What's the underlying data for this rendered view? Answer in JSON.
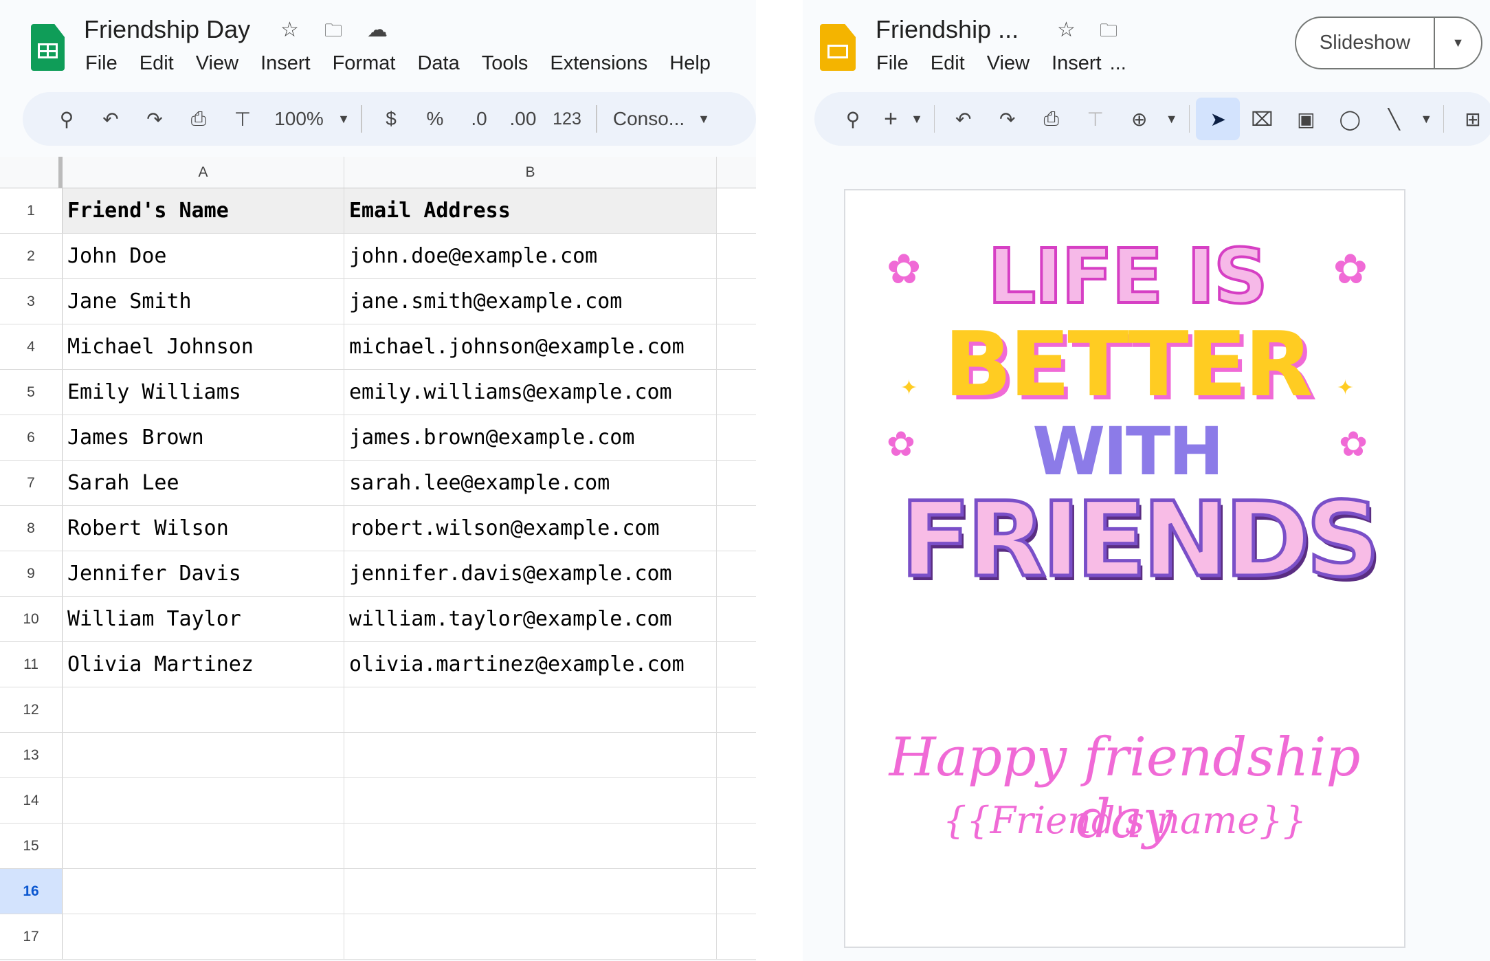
{
  "sheets": {
    "title": "Friendship Day",
    "menu": [
      "File",
      "Edit",
      "View",
      "Insert",
      "Format",
      "Data",
      "Tools",
      "Extensions",
      "Help"
    ],
    "toolbar": {
      "zoom": "100%",
      "currency": "$",
      "percent": "%",
      "dec_dec": ".0",
      "dec_inc": ".00",
      "number_format": "123",
      "font": "Conso..."
    },
    "columns": [
      "A",
      "B"
    ],
    "rows": [
      [
        "Friend's Name",
        "Email Address"
      ],
      [
        "John Doe",
        "john.doe@example.com"
      ],
      [
        "Jane Smith",
        "jane.smith@example.com"
      ],
      [
        "Michael Johnson",
        "michael.johnson@example.com"
      ],
      [
        "Emily Williams",
        "emily.williams@example.com"
      ],
      [
        "James Brown",
        "james.brown@example.com"
      ],
      [
        "Sarah Lee",
        "sarah.lee@example.com"
      ],
      [
        "Robert Wilson",
        "robert.wilson@example.com"
      ],
      [
        "Jennifer Davis",
        "jennifer.davis@example.com"
      ],
      [
        "William Taylor",
        "william.taylor@example.com"
      ],
      [
        "Olivia Martinez",
        "olivia.martinez@example.com"
      ],
      [
        "",
        ""
      ],
      [
        "",
        ""
      ],
      [
        "",
        ""
      ],
      [
        "",
        ""
      ],
      [
        "",
        ""
      ],
      [
        "",
        ""
      ]
    ],
    "selected_row": 16
  },
  "slides": {
    "title": "Friendship ...",
    "menu": [
      "File",
      "Edit",
      "View",
      "Insert",
      "..."
    ],
    "slideshow_label": "Slideshow",
    "art": {
      "line1": "LIFE IS",
      "line2": "BETTER",
      "line3": "WITH",
      "line4": "FRIENDS"
    },
    "greeting": "Happy friendship day",
    "placeholder": "{{Friend's name}}"
  },
  "colors": {
    "sheets_green": "#0f9d58",
    "slides_yellow": "#f4b400",
    "pink": "#f06ad6",
    "yellow": "#ffcc22",
    "purple": "#8c7be8",
    "dark_purple": "#5a2d82"
  }
}
